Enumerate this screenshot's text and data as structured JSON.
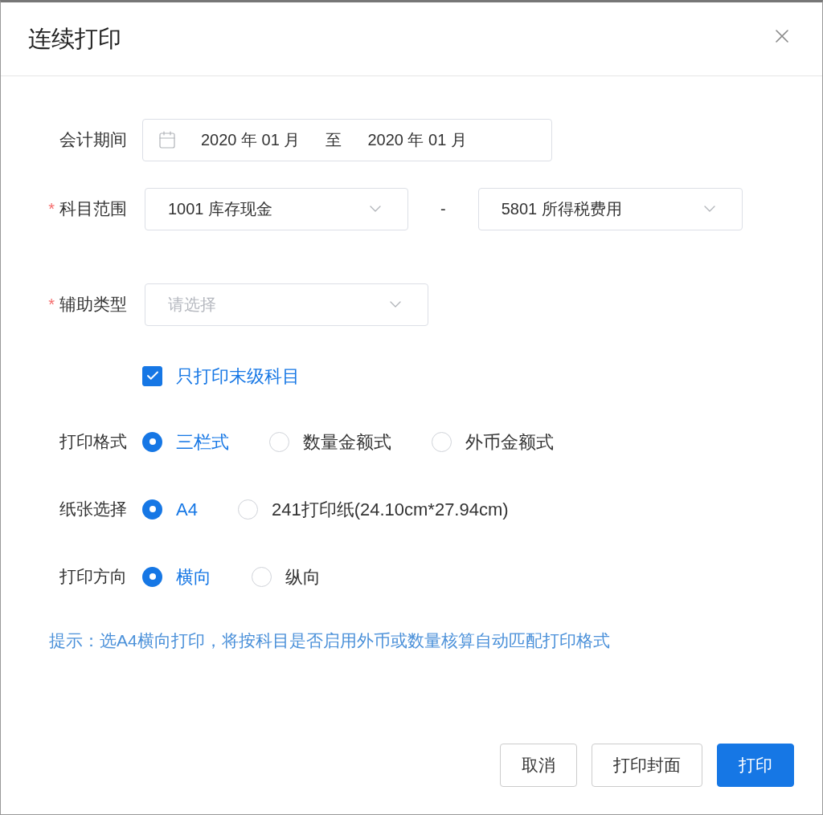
{
  "dialog": {
    "title": "连续打印"
  },
  "period": {
    "label": "会计期间",
    "start": "2020 年 01 月",
    "separator": "至",
    "end": "2020 年 01 月"
  },
  "subject_range": {
    "required_mark": "*",
    "label": "科目范围",
    "from": "1001 库存现金",
    "separator": "-",
    "to": "5801 所得税费用"
  },
  "aux_type": {
    "required_mark": "*",
    "label": "辅助类型",
    "placeholder": "请选择"
  },
  "leaf_only": {
    "label": "只打印末级科目",
    "checked": true
  },
  "radio_groups": [
    {
      "label": "打印格式",
      "options": [
        {
          "label": "三栏式",
          "selected": true
        },
        {
          "label": "数量金额式",
          "selected": false
        },
        {
          "label": "外币金额式",
          "selected": false
        }
      ]
    },
    {
      "label": "纸张选择",
      "options": [
        {
          "label": "A4",
          "selected": true
        },
        {
          "label": "241打印纸(24.10cm*27.94cm)",
          "selected": false
        }
      ]
    },
    {
      "label": "打印方向",
      "options": [
        {
          "label": "横向",
          "selected": true
        },
        {
          "label": "纵向",
          "selected": false
        }
      ]
    }
  ],
  "hint": "提示：选A4横向打印，将按科目是否启用外币或数量核算自动匹配打印格式",
  "buttons": [
    {
      "label": "取消",
      "kind": "default"
    },
    {
      "label": "打印封面",
      "kind": "default"
    },
    {
      "label": "打印",
      "kind": "primary"
    }
  ]
}
